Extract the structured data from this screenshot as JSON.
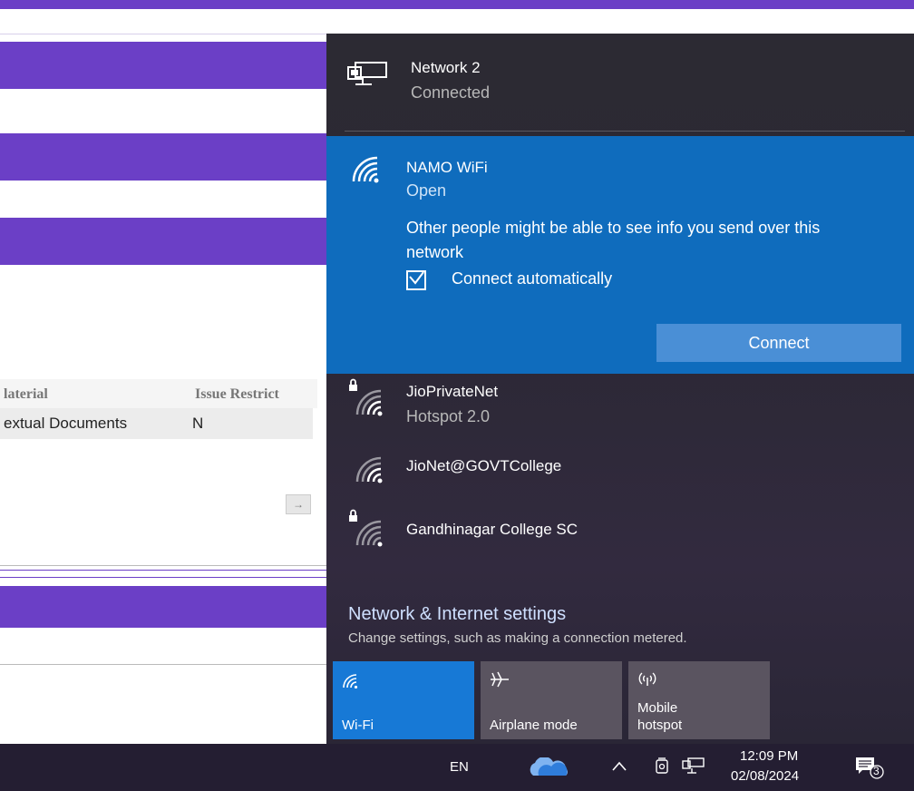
{
  "background_page": {
    "table_headers": [
      "laterial",
      "Issue Restrict"
    ],
    "table_row": [
      "extual Documents",
      "N"
    ],
    "scroll_arrow": "→"
  },
  "flyout": {
    "network_2": {
      "name": "Network 2",
      "status": "Connected",
      "icon": "ethernet-icon"
    },
    "selected": {
      "name": "NAMO WiFi",
      "status": "Open",
      "warning": "Other people might be able to see info you send over this network",
      "auto_connect_label": "Connect automatically",
      "auto_connect_checked": true,
      "connect_label": "Connect"
    },
    "networks": [
      {
        "name": "JioPrivateNet",
        "status": "Hotspot 2.0",
        "locked": true
      },
      {
        "name": "JioNet@GOVTCollege",
        "status": "",
        "locked": false
      },
      {
        "name": "Gandhinagar College SC",
        "status": "",
        "locked": true
      }
    ],
    "settings": {
      "title": "Network & Internet settings",
      "subtitle": "Change settings, such as making a connection metered."
    },
    "tiles": [
      {
        "label": "Wi-Fi",
        "active": true,
        "icon": "wifi-icon"
      },
      {
        "label": "Airplane mode",
        "active": false,
        "icon": "airplane-icon"
      },
      {
        "label_line1": "Mobile",
        "label_line2": "hotspot",
        "active": false,
        "icon": "hotspot-icon"
      }
    ]
  },
  "taskbar": {
    "language": "EN",
    "time": "12:09 PM",
    "date": "02/08/2024",
    "notifications": "3"
  },
  "colors": {
    "page_accent": "#6b3fc6",
    "flyout_bg": "#2c2a33",
    "selected_bg": "#0f6cbd",
    "tile_active": "#1779d6",
    "taskbar_bg": "#241e32"
  }
}
